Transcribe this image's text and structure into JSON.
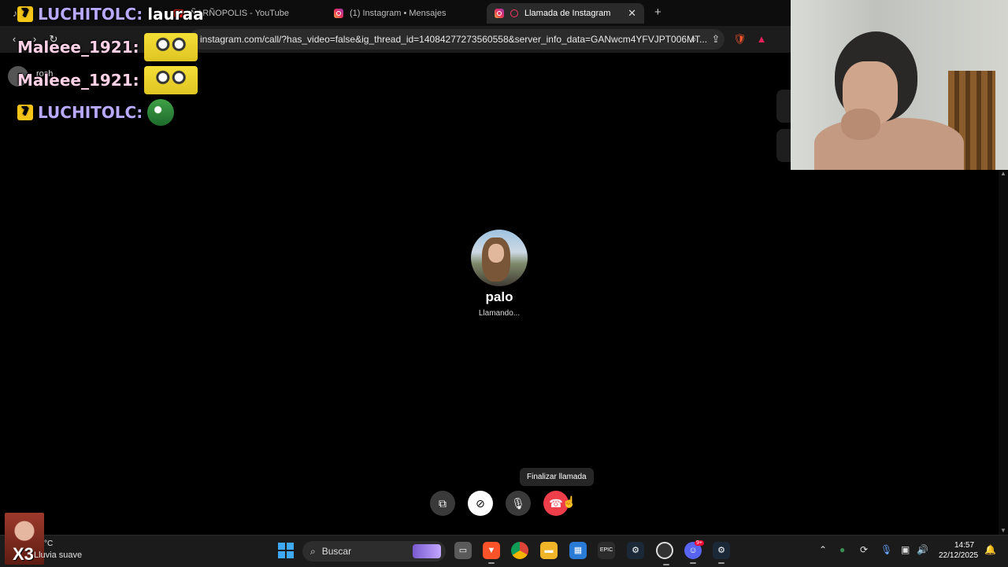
{
  "browser": {
    "tabs": [
      {
        "label": "",
        "icon": "tiktok-icon"
      },
      {
        "label": "ÑARÑOPOLIS - YouTube",
        "icon": "youtube-icon"
      },
      {
        "label": "(1) Instagram • Mensajes",
        "icon": "instagram-icon"
      },
      {
        "label": "Llamada de Instagram",
        "icon": "instagram-icon",
        "active": true
      }
    ],
    "new_tab_label": "+",
    "url": "instagram.com/call/?has_video=false&ig_thread_id=14084277273560558&server_info_data=GANwcm4YFVJPT006MT...",
    "sidebar_user": "rosh"
  },
  "chat_overlay": [
    {
      "user": "LUCHITOLC",
      "message": "lauraa"
    },
    {
      "user": "Maleee_1921",
      "message": "",
      "emote": "minion-emote"
    },
    {
      "user": "Maleee_1921",
      "message": "",
      "emote": "minion-emote"
    },
    {
      "user": "LUCHITOLC",
      "message": "",
      "emote": "frog-emote"
    }
  ],
  "call": {
    "callee_name": "palo",
    "status": "Llamando...",
    "tooltip": "Finalizar llamada",
    "controls": [
      "screen-share-icon",
      "video-off-icon",
      "microphone-icon",
      "end-call-icon"
    ]
  },
  "taskbar": {
    "weather_temp": "°C",
    "weather_desc": "Lluvia suave",
    "search_placeholder": "Buscar",
    "apps": [
      "windows-start-icon",
      "task-view-icon",
      "brave-icon",
      "chrome-icon",
      "file-explorer-icon",
      "microsoft-store-icon",
      "epic-games-icon",
      "steam-icon",
      "obs-icon",
      "discord-icon",
      "steam-icon"
    ],
    "discord_badge": "9+",
    "clock_time": "14:57",
    "clock_date": "22/12/2025"
  },
  "colors": {
    "end_call": "#ee3e4a",
    "chat_name_luchi": "#b9a9ff",
    "chat_name_male": "#ffd1e6"
  }
}
